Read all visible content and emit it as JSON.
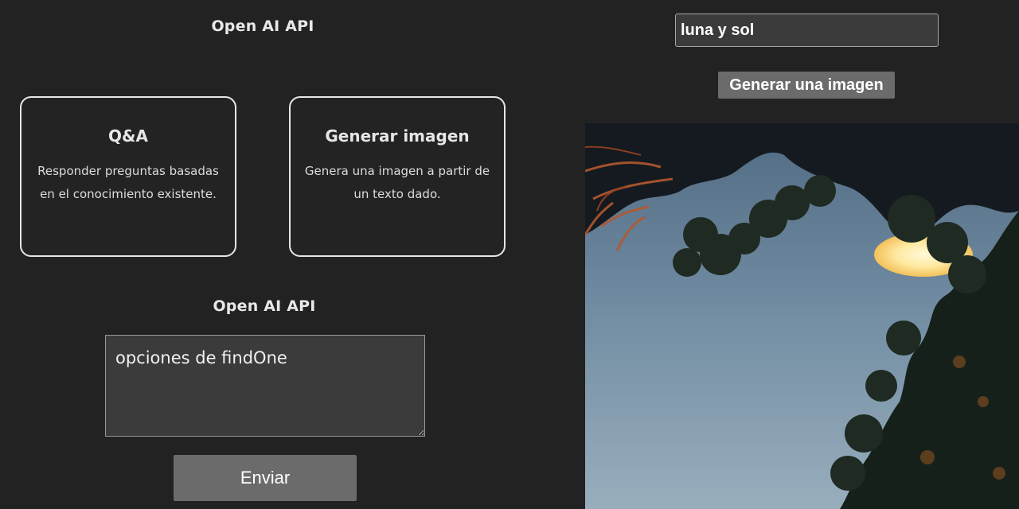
{
  "left_panel": {
    "title_top": "Open AI API",
    "cards": [
      {
        "title": "Q&A",
        "description": "Responder preguntas basadas en el conocimiento existente."
      },
      {
        "title": "Generar imagen",
        "description": "Genera una imagen a partir de un texto dado."
      }
    ],
    "title_mid": "Open AI API",
    "question_value": "opciones de findOne",
    "send_label": "Enviar"
  },
  "right_panel": {
    "prompt_value": "luna y sol",
    "generate_label": "Generar una imagen"
  },
  "colors": {
    "background": "#222222",
    "button": "#6b6b6b",
    "input_bg": "#3b3b3b",
    "card_border": "#e6e6e6"
  }
}
